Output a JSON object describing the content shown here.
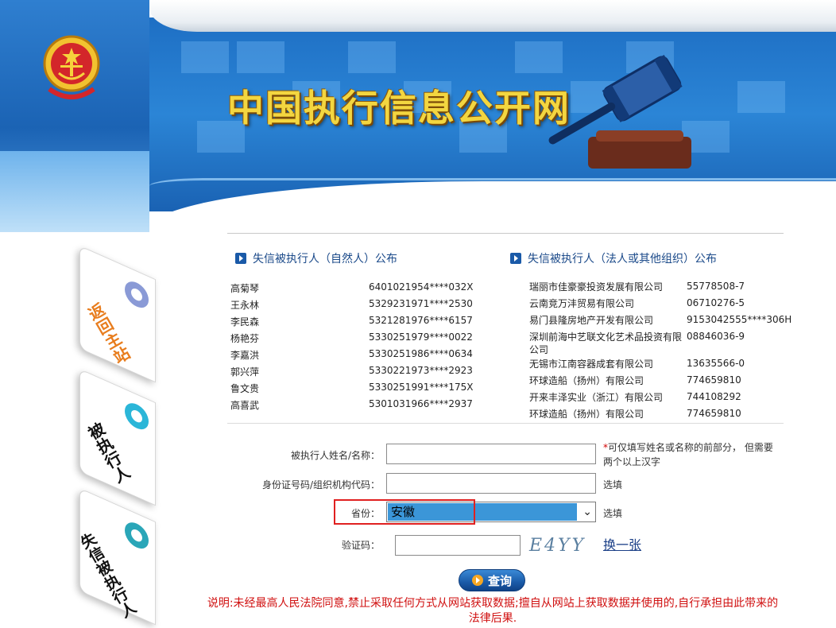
{
  "header": {
    "site_title": "中国执行信息公开网"
  },
  "side_tabs": [
    {
      "label": "返回主站",
      "color": "#e87d1e",
      "dot_color": "#8a9ad6"
    },
    {
      "label": "被执行人",
      "color": "#111111",
      "dot_color": "#2bb6d8"
    },
    {
      "label": "失信被执行人",
      "color": "#111111",
      "dot_color": "#2aa6b8"
    }
  ],
  "lists": {
    "natural_person": {
      "title": "失信被执行人（自然人）公布",
      "rows": [
        {
          "name": "高菊琴",
          "id": "6401021954****032X"
        },
        {
          "name": "王永林",
          "id": "5329231971****2530"
        },
        {
          "name": "李民森",
          "id": "5321281976****6157"
        },
        {
          "name": "杨艳芬",
          "id": "5330251979****0022"
        },
        {
          "name": "李嘉洪",
          "id": "5330251986****0634"
        },
        {
          "name": "郭兴萍",
          "id": "5330221973****2923"
        },
        {
          "name": "鲁文贵",
          "id": "5330251991****175X"
        },
        {
          "name": "高喜武",
          "id": "5301031966****2937"
        }
      ]
    },
    "legal_entity": {
      "title": "失信被执行人（法人或其他组织）公布",
      "rows": [
        {
          "name": "瑞丽市佳豪豪投资发展有限公司",
          "id": "55778508-7"
        },
        {
          "name": "云南竞万沣贸易有限公司",
          "id": "06710276-5"
        },
        {
          "name": "易门县隆房地产开发有限公司",
          "id": "9153042555****306H"
        },
        {
          "name": "深圳前海中艺联文化艺术品投资有限公司",
          "id": "08846036-9"
        },
        {
          "name": "无锡市江南容器成套有限公司",
          "id": "13635566-0"
        },
        {
          "name": "环球造船（扬州）有限公司",
          "id": "774659810"
        },
        {
          "name": "开来丰泽实业（浙江）有限公司",
          "id": "744108292"
        },
        {
          "name": "环球造船（扬州）有限公司",
          "id": "774659810"
        }
      ]
    }
  },
  "form": {
    "name_label": "被执行人姓名/名称：",
    "name_value": "",
    "name_note_star": "*",
    "name_note": "可仅填写姓名或名称的前部分， 但需要两个以上汉字",
    "id_label": "身份证号码/组织机构代码：",
    "id_value": "",
    "id_note": "选填",
    "province_label": "省份：",
    "province_value": "安徽",
    "province_note": "选填",
    "captcha_label": "验证码：",
    "captcha_value": "",
    "captcha_text": "E4YY",
    "refresh_label": "换一张",
    "query_label": "查询"
  },
  "disclaimer": "说明:未经最高人民法院同意,禁止采取任何方式从网站获取数据;擅自从网站上获取数据并使用的,自行承担由此带来的法律后果.",
  "colors": {
    "banner_blue": "#1e6fc4",
    "title_gold": "#f3d640",
    "link_blue": "#1b3f87",
    "warning_red": "#d01010"
  }
}
